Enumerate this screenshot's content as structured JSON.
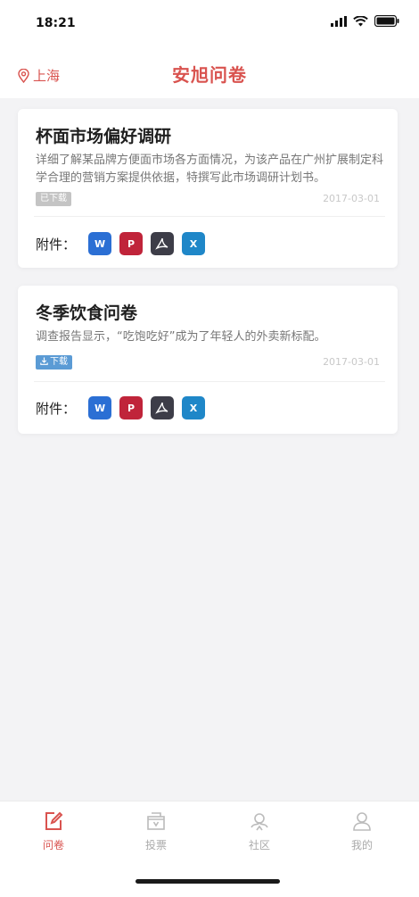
{
  "status_bar": {
    "time": "18:21"
  },
  "header": {
    "location": "上海",
    "title": "安旭问卷"
  },
  "surveys": [
    {
      "title": "杯面市场偏好调研",
      "description": "详细了解某品牌方便面市场各方面情况，为该产品在广州扩展制定科学合理的营销方案提供依据，特撰写此市场调研计划书。",
      "badge": "已下载",
      "date": "2017-03-01",
      "attachments_label": "附件：",
      "attachments": [
        "word",
        "ppt",
        "pdf",
        "excel"
      ]
    },
    {
      "title": "冬季饮食问卷",
      "description": "调查报告显示，“吃饱吃好”成为了年轻人的外卖新标配。",
      "badge": "下载",
      "date": "2017-03-01",
      "attachments_label": "附件：",
      "attachments": [
        "word",
        "ppt",
        "pdf",
        "excel"
      ]
    }
  ],
  "tabbar": {
    "items": [
      {
        "label": "问卷",
        "icon": "edit-icon",
        "active": true
      },
      {
        "label": "投票",
        "icon": "ballot-box-icon",
        "active": false
      },
      {
        "label": "社区",
        "icon": "community-icon",
        "active": false
      },
      {
        "label": "我的",
        "icon": "user-icon",
        "active": false
      }
    ]
  },
  "colors": {
    "accent": "#d9534f",
    "badge_download": "#5b9bd5",
    "badge_downloaded": "#c4c4c4"
  }
}
